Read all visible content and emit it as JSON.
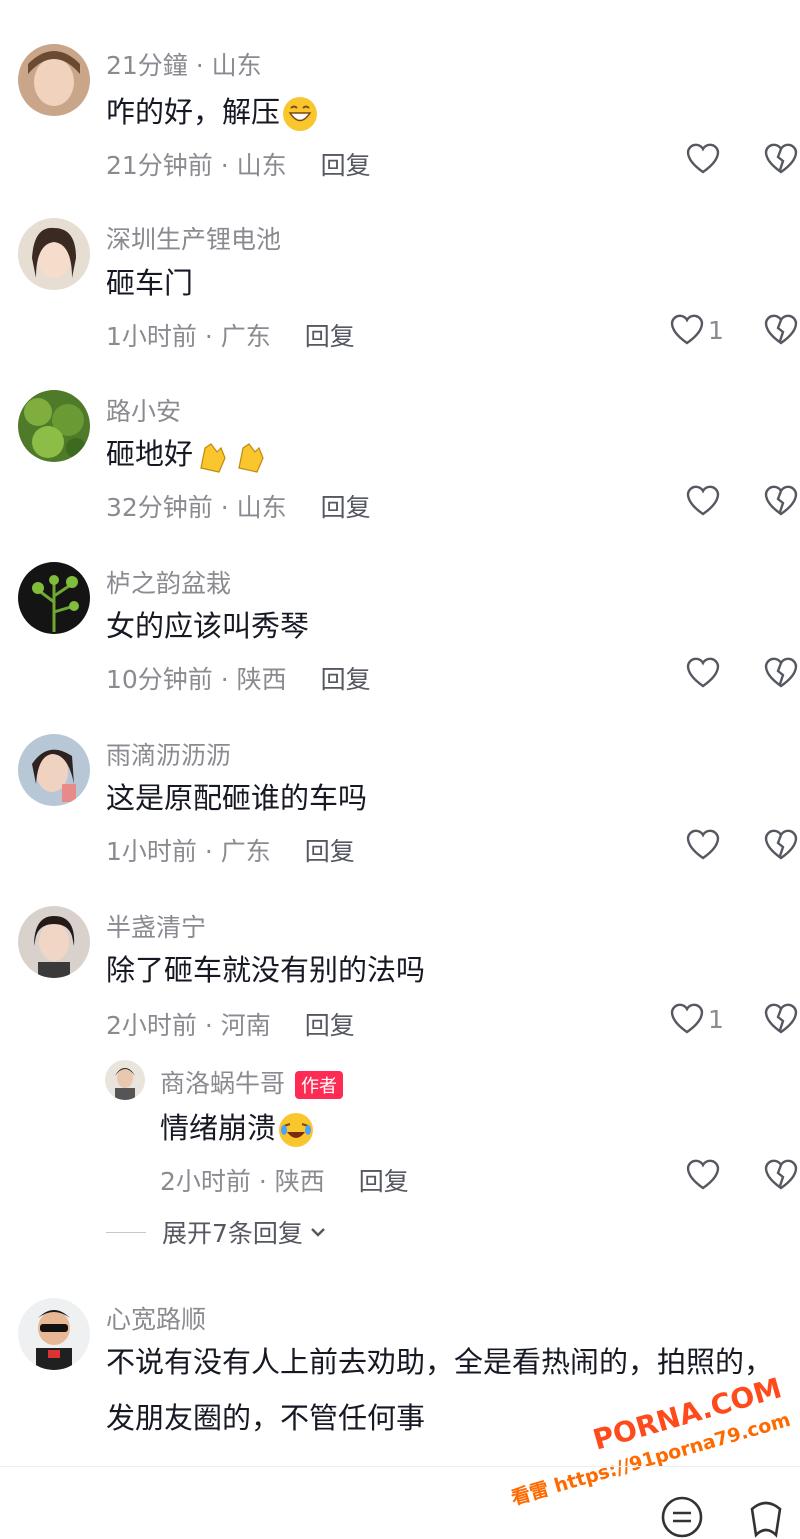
{
  "comments": [
    {
      "user": "21分鐘 · 山东",
      "text": "咋的好，解压",
      "emoji": "grin",
      "time": "21分钟前 · 山东",
      "reply": "回复",
      "likes": ""
    },
    {
      "user": "深圳生产锂电池",
      "text": "砸车门",
      "time": "1小时前 · 广东",
      "reply": "回复",
      "likes": "1"
    },
    {
      "user": "路小安",
      "text": "砸地好",
      "emoji": "clap",
      "time": "32分钟前 · 山东",
      "reply": "回复",
      "likes": ""
    },
    {
      "user": "栌之韵盆栽",
      "text": "女的应该叫秀琴",
      "time": "10分钟前 · 陕西",
      "reply": "回复",
      "likes": ""
    },
    {
      "user": "雨滴沥沥沥",
      "text": "这是原配砸谁的车吗",
      "time": "1小时前 · 广东",
      "reply": "回复",
      "likes": ""
    },
    {
      "user": "半盏清宁",
      "text": "除了砸车就没有别的法吗",
      "time": "2小时前 · 河南",
      "reply": "回复",
      "likes": "1"
    }
  ],
  "author_reply": {
    "user": "商洛蜗牛哥",
    "badge": "作者",
    "text": "情绪崩溃",
    "emoji": "crying-laugh",
    "time": "2小时前 · 陕西",
    "reply": "回复"
  },
  "expand_label": "展开7条回复",
  "last_comment": {
    "user": "心宽路顺",
    "text": "不说有没有人上前去劝助，全是看热闹的，拍照的，发朋友圈的，不管任何事"
  },
  "watermark": {
    "logo": "PORNA.COM",
    "url": "看雷 https://91porna79.com"
  },
  "colors": {
    "text": "#161823",
    "secondary": "#8a8b91",
    "badge": "#fe2c55"
  }
}
